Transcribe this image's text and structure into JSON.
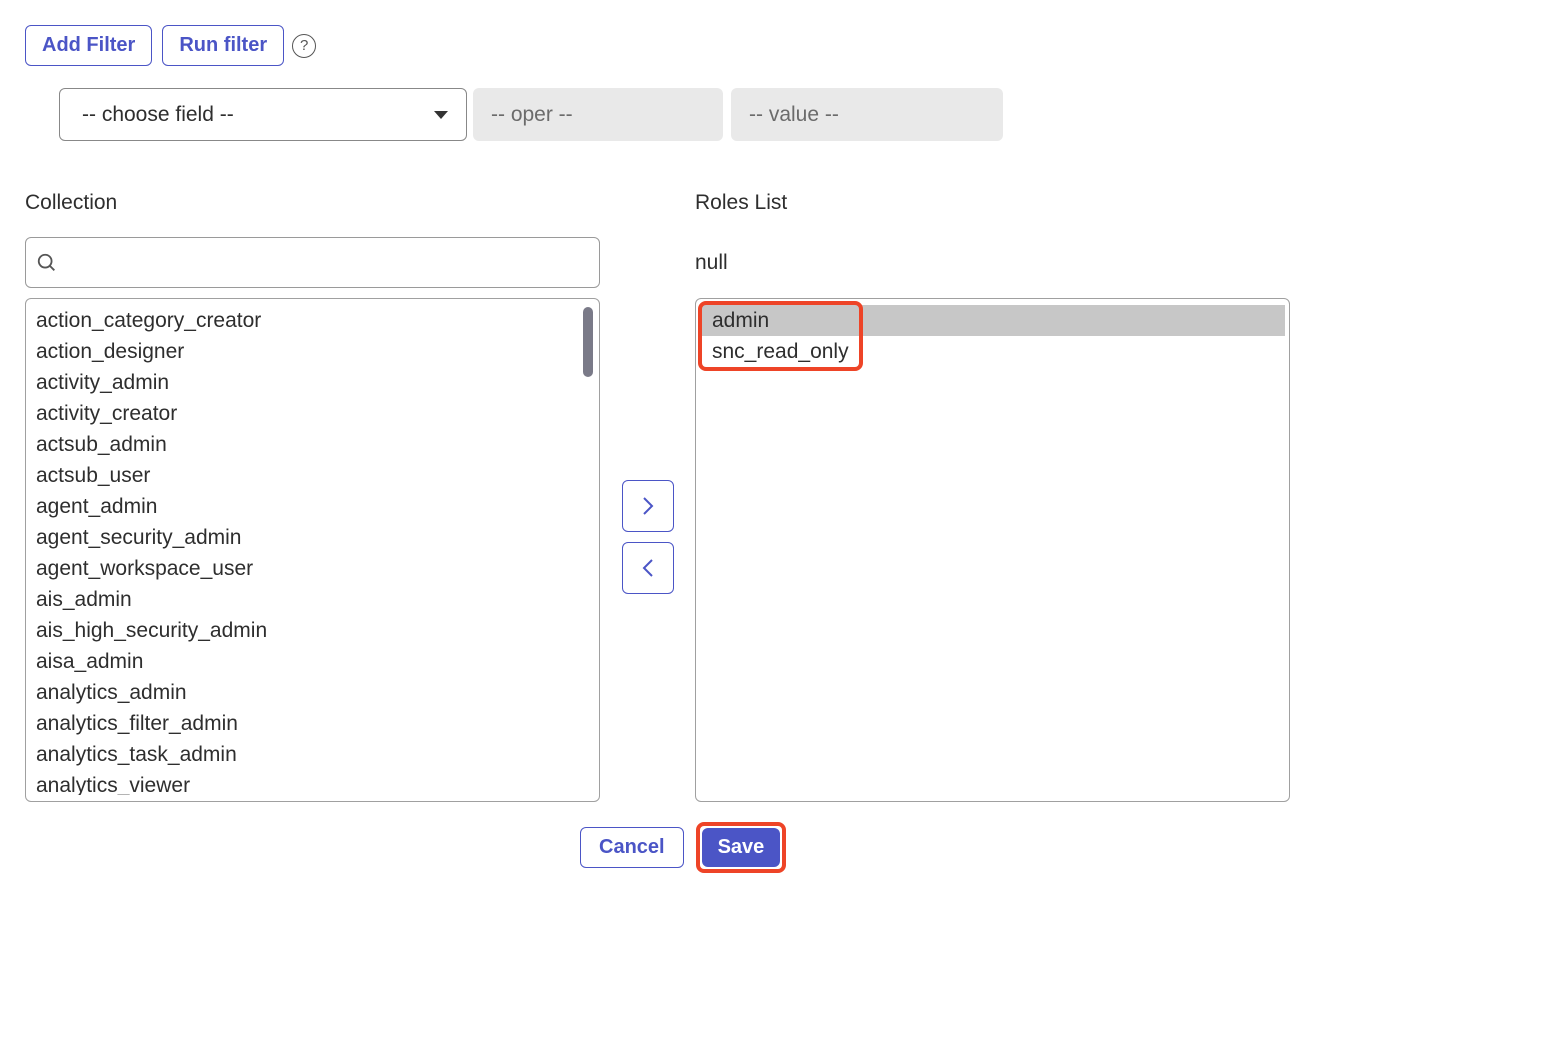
{
  "toolbar": {
    "add_filter_label": "Add Filter",
    "run_filter_label": "Run filter"
  },
  "filter_row": {
    "choose_field_placeholder": "-- choose field --",
    "oper_placeholder": "-- oper --",
    "value_placeholder": "-- value --"
  },
  "collection": {
    "label": "Collection",
    "search_value": "",
    "items": [
      "action_category_creator",
      "action_designer",
      "activity_admin",
      "activity_creator",
      "actsub_admin",
      "actsub_user",
      "agent_admin",
      "agent_security_admin",
      "agent_workspace_user",
      "ais_admin",
      "ais_high_security_admin",
      "aisa_admin",
      "analytics_admin",
      "analytics_filter_admin",
      "analytics_task_admin",
      "analytics_viewer"
    ]
  },
  "roles": {
    "label": "Roles List",
    "null_text": "null",
    "items": [
      "admin",
      "snc_read_only"
    ]
  },
  "footer": {
    "cancel_label": "Cancel",
    "save_label": "Save"
  }
}
